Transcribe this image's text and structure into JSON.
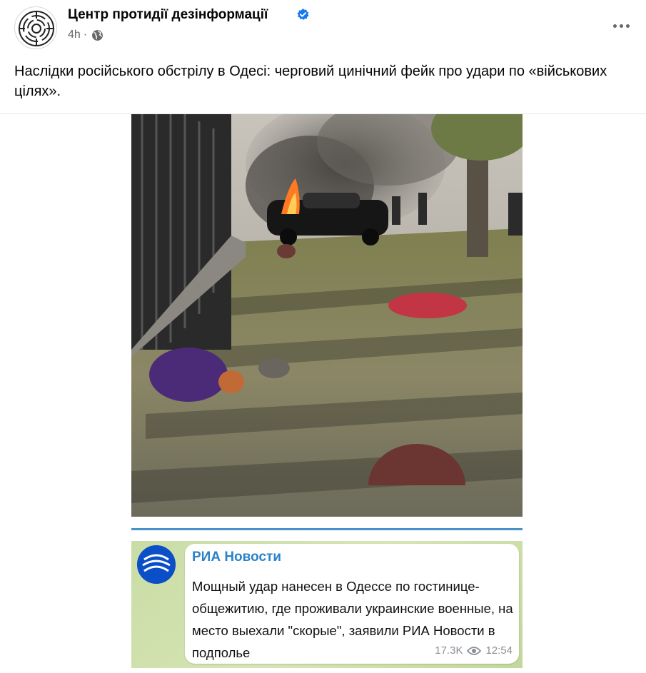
{
  "post": {
    "page_name": "Центр протидії дезінформації",
    "verified_icon": "verified-badge-icon",
    "time": "4h",
    "separator": "·",
    "audience_icon": "globe-icon",
    "more_icon": "more-options-icon",
    "text": "Наслідки російського обстрілу в Одесі: черговий цинічний фейк про удари по «військових цілях»."
  },
  "media": {
    "photo_icon": "street-scene-photo",
    "telegram": {
      "channel": "РИА Новости",
      "message": "Мощный удар нанесен в Одессе по гостинице-общежитию, где проживали украинские военные, на место выехали \"скорые\", заявили РИА Новости в подполье",
      "views": "17.3K",
      "time": "12:54",
      "views_icon": "eye-icon"
    }
  },
  "colors": {
    "verified": "#1877f2",
    "meta_text": "#65676b",
    "channel": "#2b82c8",
    "tg_accent": "#4a90c8"
  }
}
